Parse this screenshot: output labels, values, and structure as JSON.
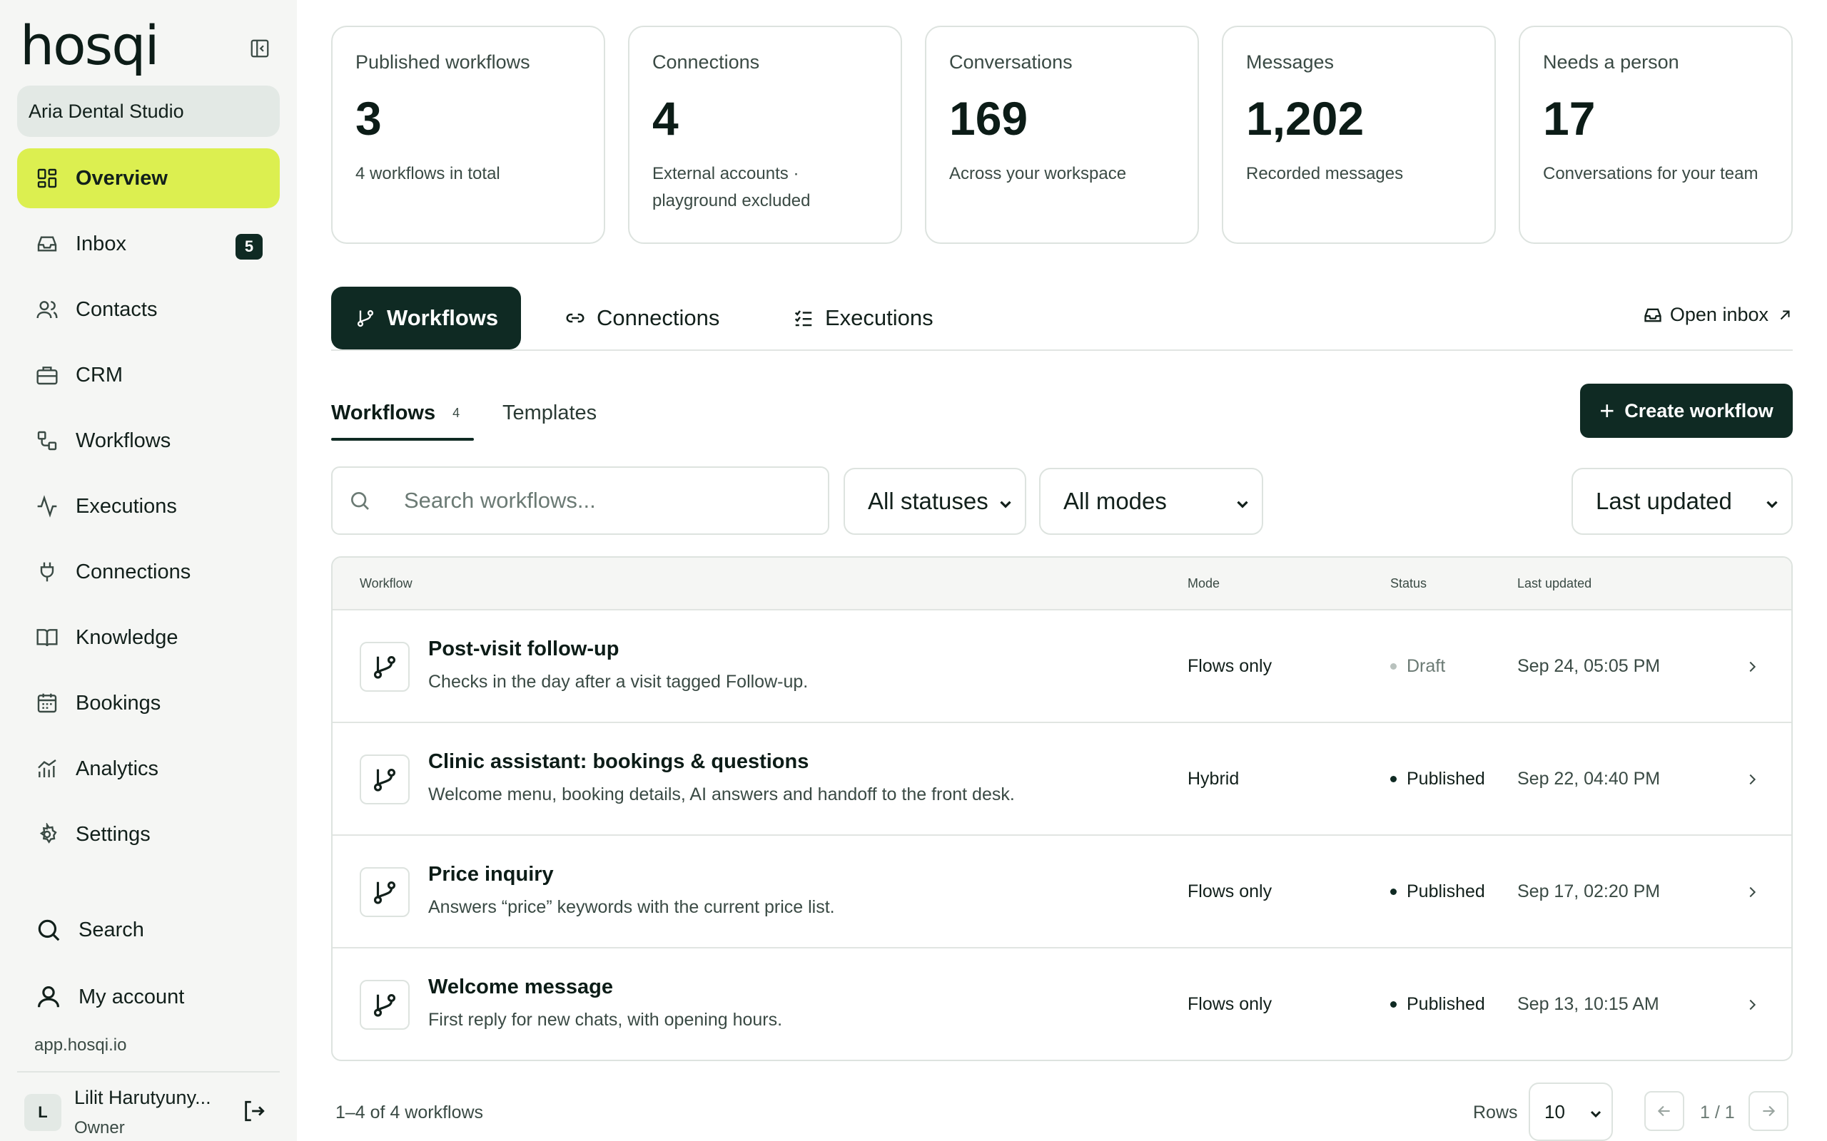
{
  "app": {
    "logo_text": "hosqi",
    "domain": "app.hosqi.io"
  },
  "workspace": {
    "name": "Aria Dental Studio"
  },
  "sidebar": {
    "items": [
      {
        "label": "Overview",
        "icon": "grid-icon",
        "active": true
      },
      {
        "label": "Inbox",
        "icon": "inbox-icon",
        "badge": "5"
      },
      {
        "label": "Contacts",
        "icon": "users-icon"
      },
      {
        "label": "CRM",
        "icon": "briefcase-icon"
      },
      {
        "label": "Workflows",
        "icon": "workflow-icon"
      },
      {
        "label": "Executions",
        "icon": "activity-icon"
      },
      {
        "label": "Connections",
        "icon": "plug-icon"
      },
      {
        "label": "Knowledge",
        "icon": "book-icon"
      },
      {
        "label": "Bookings",
        "icon": "calendar-icon"
      },
      {
        "label": "Analytics",
        "icon": "chart-icon"
      },
      {
        "label": "Settings",
        "icon": "gear-icon"
      }
    ],
    "search_label": "Search",
    "account_label": "My account"
  },
  "user": {
    "initial": "L",
    "name": "Lilit Harutyuny...",
    "role": "Owner"
  },
  "stats": [
    {
      "label": "Published workflows",
      "value": "3",
      "sub": "4 workflows in total"
    },
    {
      "label": "Connections",
      "value": "4",
      "sub": "External accounts · playground excluded"
    },
    {
      "label": "Conversations",
      "value": "169",
      "sub": "Across your workspace"
    },
    {
      "label": "Messages",
      "value": "1,202",
      "sub": "Recorded messages"
    },
    {
      "label": "Needs a person",
      "value": "17",
      "sub": "Conversations for your team"
    }
  ],
  "tabs": [
    {
      "label": "Workflows",
      "active": true
    },
    {
      "label": "Connections"
    },
    {
      "label": "Executions"
    }
  ],
  "open_inbox_label": "Open inbox",
  "subtabs": {
    "workflows_label": "Workflows",
    "workflows_count": "4",
    "templates_label": "Templates"
  },
  "create_button_label": "Create workflow",
  "filters": {
    "search_placeholder": "Search workflows...",
    "status": "All statuses",
    "mode": "All modes",
    "sort": "Last updated"
  },
  "table": {
    "headers": {
      "workflow": "Workflow",
      "mode": "Mode",
      "status": "Status",
      "updated": "Last updated"
    },
    "rows": [
      {
        "title": "Post-visit follow-up",
        "description": "Checks in the day after a visit tagged Follow-up.",
        "mode": "Flows only",
        "status": "Draft",
        "updated": "Sep 24, 05:05 PM"
      },
      {
        "title": "Clinic assistant: bookings & questions",
        "description": "Welcome menu, booking details, AI answers and handoff to the front desk.",
        "mode": "Hybrid",
        "status": "Published",
        "updated": "Sep 22, 04:40 PM"
      },
      {
        "title": "Price inquiry",
        "description": "Answers “price” keywords with the current price list.",
        "mode": "Flows only",
        "status": "Published",
        "updated": "Sep 17, 02:20 PM"
      },
      {
        "title": "Welcome message",
        "description": "First reply for new chats, with opening hours.",
        "mode": "Flows only",
        "status": "Published",
        "updated": "Sep 13, 10:15 AM"
      }
    ]
  },
  "footer": {
    "count_text": "1–4 of 4 workflows",
    "rows_label": "Rows",
    "rows_value": "10",
    "page_label": "1 / 1"
  },
  "colors": {
    "accent": "#dcef50",
    "primary": "#0f2a23",
    "border": "#dde3df",
    "sidebar_bg": "#f5f6f4"
  }
}
